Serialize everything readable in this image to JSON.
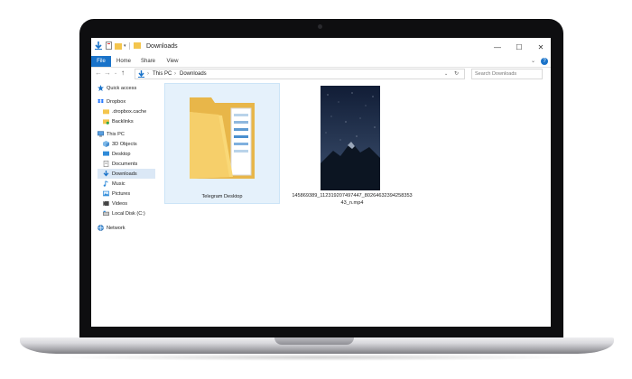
{
  "window": {
    "title": "Downloads",
    "controls": {
      "minimize": "—",
      "maximize": "☐",
      "close": "✕"
    }
  },
  "ribbon": {
    "tabs": [
      "File",
      "Home",
      "Share",
      "View"
    ],
    "help": "?"
  },
  "address_bar": {
    "path": [
      "This PC",
      "Downloads"
    ],
    "separator": "›",
    "search_placeholder": "Search Downloads"
  },
  "nav_pane": {
    "items": [
      {
        "label": "Quick access",
        "icon": "star-icon"
      },
      {
        "label": "Dropbox",
        "icon": "dropbox-icon"
      },
      {
        "label": ".dropbox.cache",
        "icon": "folder-icon"
      },
      {
        "label": "Backlinks",
        "icon": "folder-green-icon"
      },
      {
        "label": "This PC",
        "icon": "computer-icon"
      },
      {
        "label": "3D Objects",
        "icon": "3d-objects-icon"
      },
      {
        "label": "Desktop",
        "icon": "desktop-icon"
      },
      {
        "label": "Documents",
        "icon": "documents-icon"
      },
      {
        "label": "Downloads",
        "icon": "downloads-icon",
        "selected": true
      },
      {
        "label": "Music",
        "icon": "music-icon"
      },
      {
        "label": "Pictures",
        "icon": "pictures-icon"
      },
      {
        "label": "Videos",
        "icon": "videos-icon"
      },
      {
        "label": "Local Disk (C:)",
        "icon": "disk-icon"
      },
      {
        "label": "Network",
        "icon": "network-icon"
      }
    ]
  },
  "files": [
    {
      "name": "Telegram Desktop",
      "type": "folder",
      "selected": true
    },
    {
      "name_line1": "145869389_11231920749744​7_8026463239425835​3",
      "name_line2": "43_n.mp4",
      "type": "video"
    }
  ],
  "colors": {
    "accent": "#1a73c9",
    "selection": "#e5f1fb",
    "folder": "#f6cf6a"
  }
}
